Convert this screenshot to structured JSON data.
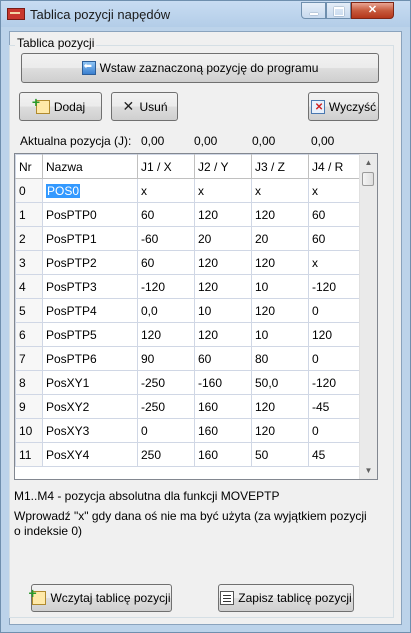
{
  "window": {
    "title": "Tablica pozycji napędów"
  },
  "group": {
    "title": "Tablica pozycji"
  },
  "buttons": {
    "insert": "Wstaw zaznaczoną pozycję do programu",
    "add": "Dodaj",
    "remove": "Usuń",
    "clear": "Wyczyść",
    "load": "Wczytaj tablicę pozycji",
    "save": "Zapisz tablicę pozycji"
  },
  "current_position": {
    "label": "Aktualna pozycja (J):",
    "values": [
      "0,00",
      "0,00",
      "0,00",
      "0,00"
    ]
  },
  "table": {
    "headers": [
      "Nr",
      "Nazwa",
      "J1 / X",
      "J2 / Y",
      "J3 / Z",
      "J4 / R"
    ],
    "rows": [
      [
        "0",
        "POS0",
        "x",
        "x",
        "x",
        "x"
      ],
      [
        "1",
        "PosPTP0",
        "60",
        "120",
        "120",
        "60"
      ],
      [
        "2",
        "PosPTP1",
        "-60",
        "20",
        "20",
        "60"
      ],
      [
        "3",
        "PosPTP2",
        "60",
        "120",
        "120",
        "x"
      ],
      [
        "4",
        "PosPTP3",
        "-120",
        "120",
        "10",
        "-120"
      ],
      [
        "5",
        "PosPTP4",
        "0,0",
        "10",
        "120",
        "0"
      ],
      [
        "6",
        "PosPTP5",
        "120",
        "120",
        "10",
        "120"
      ],
      [
        "7",
        "PosPTP6",
        "90",
        "60",
        "80",
        "0"
      ],
      [
        "8",
        "PosXY1",
        "-250",
        "-160",
        "50,0",
        "-120"
      ],
      [
        "9",
        "PosXY2",
        "-250",
        "160",
        "120",
        "-45"
      ],
      [
        "10",
        "PosXY3",
        "0",
        "160",
        "120",
        "0"
      ],
      [
        "11",
        "PosXY4",
        "250",
        "160",
        "50",
        "45"
      ]
    ]
  },
  "info": {
    "line1": "M1..M4 - pozycja absolutna dla funkcji MOVEPTP",
    "line2": "Wprowadź \"x\" gdy dana oś nie ma być użyta (za wyjątkiem pozycji",
    "line3": "o indeksie 0)"
  }
}
